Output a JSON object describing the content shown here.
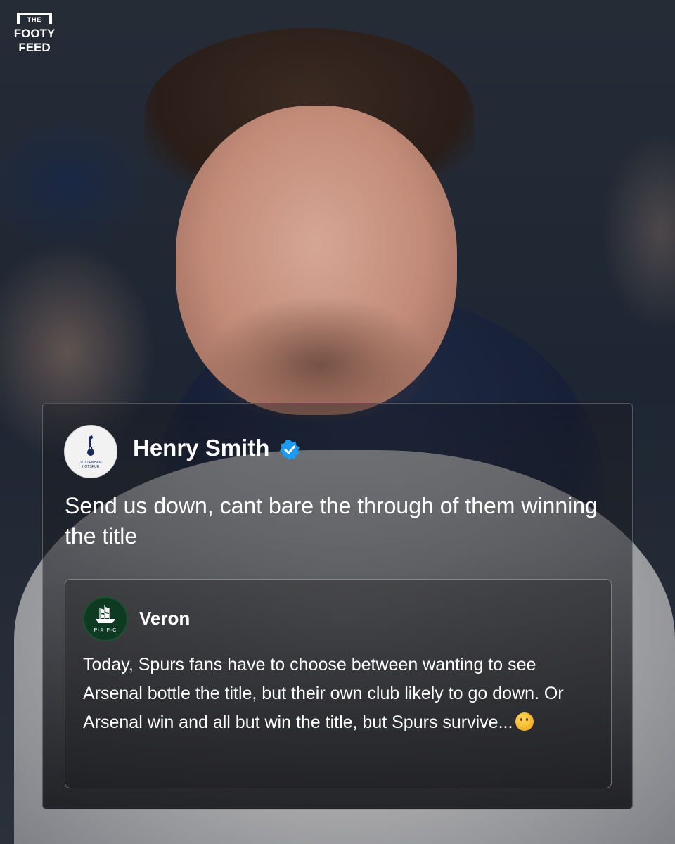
{
  "brand": {
    "logo_line_1": "THE",
    "logo_line_2": "FOOTY",
    "logo_line_3": "FEED"
  },
  "tweet": {
    "author": "Henry Smith",
    "verified": true,
    "avatar_icon": "tottenham-crest-icon",
    "text": "Send us down, cant bare the through of them winning the title"
  },
  "quoted_tweet": {
    "author": "Veron",
    "avatar_icon": "plymouth-argyle-crest-icon",
    "avatar_text": "P·A·F·C",
    "text": "Today, Spurs fans have to choose between wanting to see Arsenal bottle the title, but their own club likely to go down. Or Arsenal win and all but win the title, but Spurs survive...",
    "emoji": "thinking-face-emoji"
  },
  "colors": {
    "verified_badge": "#1d9bf0",
    "text": "#ffffff",
    "card_border": "rgba(255,255,255,0.25)"
  }
}
